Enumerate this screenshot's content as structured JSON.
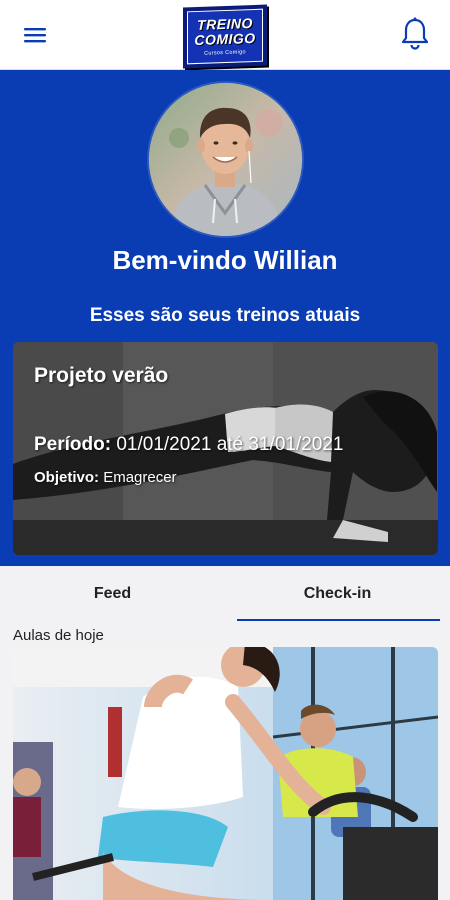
{
  "header": {
    "logo_line1": "TREINO",
    "logo_line2": "COMIGO",
    "logo_tagline": "Cursos Comigo"
  },
  "hero": {
    "welcome": "Bem-vindo Willian",
    "subtitle": "Esses são seus treinos atuais"
  },
  "workout": {
    "title": "Projeto verão",
    "period_label": "Período:",
    "period_value": "01/01/2021 até 31/01/2021",
    "goal_label": "Objetivo:",
    "goal_value": "Emagrecer"
  },
  "tabs": [
    {
      "label": "Feed",
      "active": false
    },
    {
      "label": "Check-in",
      "active": true
    }
  ],
  "section": {
    "today_label": "Aulas de hoje"
  },
  "colors": {
    "primary": "#0a3db4",
    "header_bg": "#ffffff",
    "page_bg": "#f2f2f4"
  },
  "icons": {
    "menu": "hamburger-menu-icon",
    "notifications": "bell-icon"
  }
}
